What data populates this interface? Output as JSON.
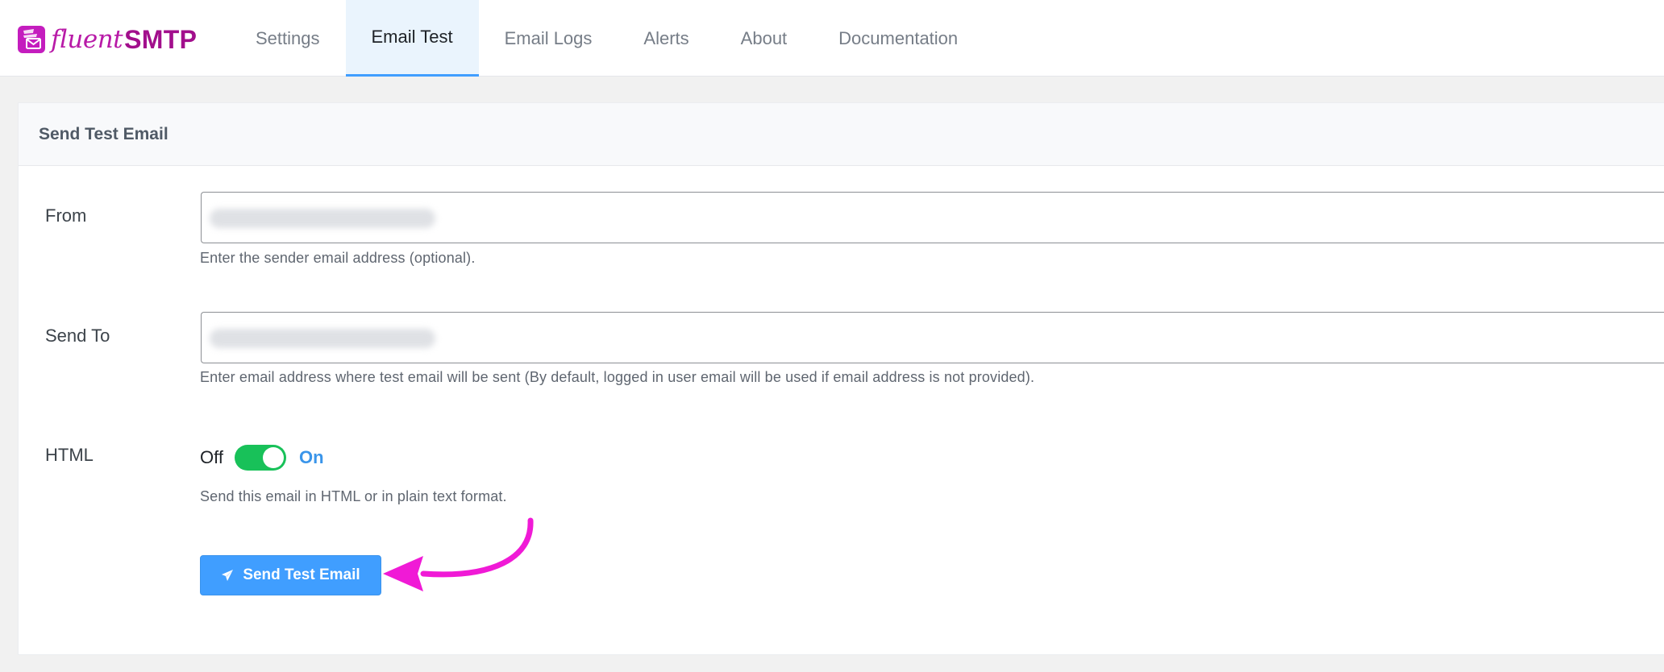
{
  "brand": {
    "name_part1": "fluent",
    "name_part2": "SMTP",
    "color": "#b81aa7"
  },
  "nav": {
    "items": [
      {
        "label": "Settings",
        "active": false
      },
      {
        "label": "Email Test",
        "active": true
      },
      {
        "label": "Email Logs",
        "active": false
      },
      {
        "label": "Alerts",
        "active": false
      },
      {
        "label": "About",
        "active": false
      },
      {
        "label": "Documentation",
        "active": false
      }
    ]
  },
  "card": {
    "title": "Send Test Email"
  },
  "form": {
    "from": {
      "label": "From",
      "value": "",
      "help": "Enter the sender email address (optional)."
    },
    "send_to": {
      "label": "Send To",
      "value": "",
      "help": "Enter email address where test email will be sent (By default, logged in user email will be used if email address is not provided)."
    },
    "html": {
      "label": "HTML",
      "off_label": "Off",
      "on_label": "On",
      "enabled": true,
      "help": "Send this email in HTML or in plain text format."
    },
    "submit": {
      "label": "Send Test Email",
      "icon": "paper-plane-icon"
    }
  },
  "colors": {
    "accent": "#409eff",
    "toggle_on": "#18c159",
    "annotation_arrow": "#f01ad6"
  }
}
